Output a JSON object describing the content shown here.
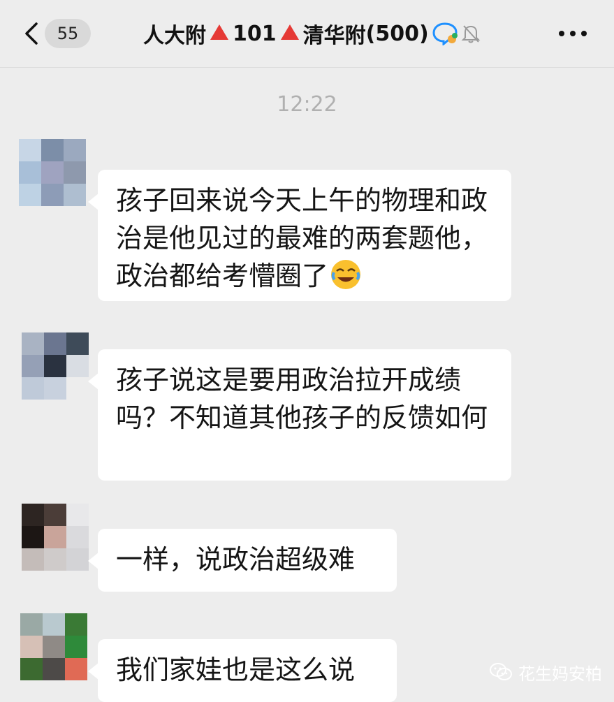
{
  "header": {
    "unread_count": "55",
    "group_name_part1": "人大附",
    "group_name_part2": "101",
    "group_name_part3": "清华附",
    "member_count": "(500)",
    "back_icon": "chevron-left-icon",
    "group_type_icon": "qq-group-icon",
    "mute_icon": "bell-muted-icon",
    "more_icon": "more-dots-icon",
    "accent_triangle_color": "#e53935"
  },
  "timestamp": "12:22",
  "messages": [
    {
      "text": "孩子回来说今天上午的物理和政治是他见过的最难的两套题他，政治都给考懵圈了",
      "emoji": "crying-laughing-emoji"
    },
    {
      "text": "孩子说这是要用政治拉开成绩吗？不知道其他孩子的反馈如何"
    },
    {
      "text": "一样，说政治超级难"
    },
    {
      "text": "我们家娃也是这么说"
    }
  ],
  "watermark": {
    "icon": "wechat-icon",
    "text": "花生妈安柏"
  },
  "colors": {
    "background": "#ededed",
    "bubble": "#ffffff",
    "timestamp": "#b0b0b0"
  }
}
